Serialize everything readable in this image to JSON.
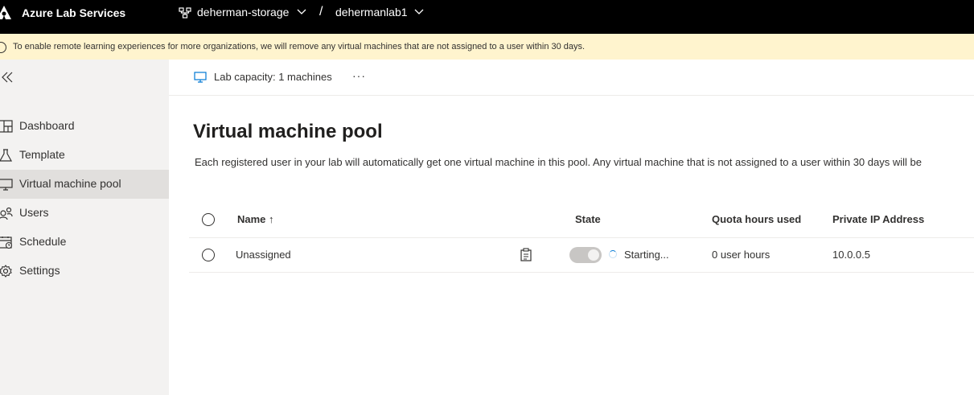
{
  "topbar": {
    "app_title": "Azure Lab Services",
    "plan_name": "deherman-storage",
    "separator": "/",
    "lab_name": "dehermanlab1"
  },
  "banner": {
    "text": "To enable remote learning experiences for more organizations, we will remove any virtual machines that are not assigned to a user within 30 days."
  },
  "sidebar": {
    "items": [
      {
        "label": "Dashboard",
        "icon": "dashboard-icon"
      },
      {
        "label": "Template",
        "icon": "beaker-icon"
      },
      {
        "label": "Virtual machine pool",
        "icon": "monitor-icon",
        "active": true
      },
      {
        "label": "Users",
        "icon": "users-icon"
      },
      {
        "label": "Schedule",
        "icon": "calendar-icon"
      },
      {
        "label": "Settings",
        "icon": "gear-icon"
      }
    ]
  },
  "commandbar": {
    "capacity_label": "Lab capacity: 1 machines",
    "more": "···"
  },
  "main": {
    "title": "Virtual machine pool",
    "description": "Each registered user in your lab will automatically get one virtual machine in this pool. Any virtual machine that is not assigned to a user within 30 days will be"
  },
  "table": {
    "columns": [
      "Name ↑",
      "State",
      "Quota hours used",
      "Private IP Address"
    ],
    "rows": [
      {
        "name": "Unassigned",
        "state": "Starting...",
        "quota": "0 user hours",
        "ip": "10.0.0.5"
      }
    ]
  },
  "colors": {
    "topbar_bg": "#000000",
    "banner_bg": "#fff4ce",
    "sidebar_bg": "#f3f2f1",
    "active_bg": "#e1dfdd",
    "accent": "#0078d4"
  }
}
